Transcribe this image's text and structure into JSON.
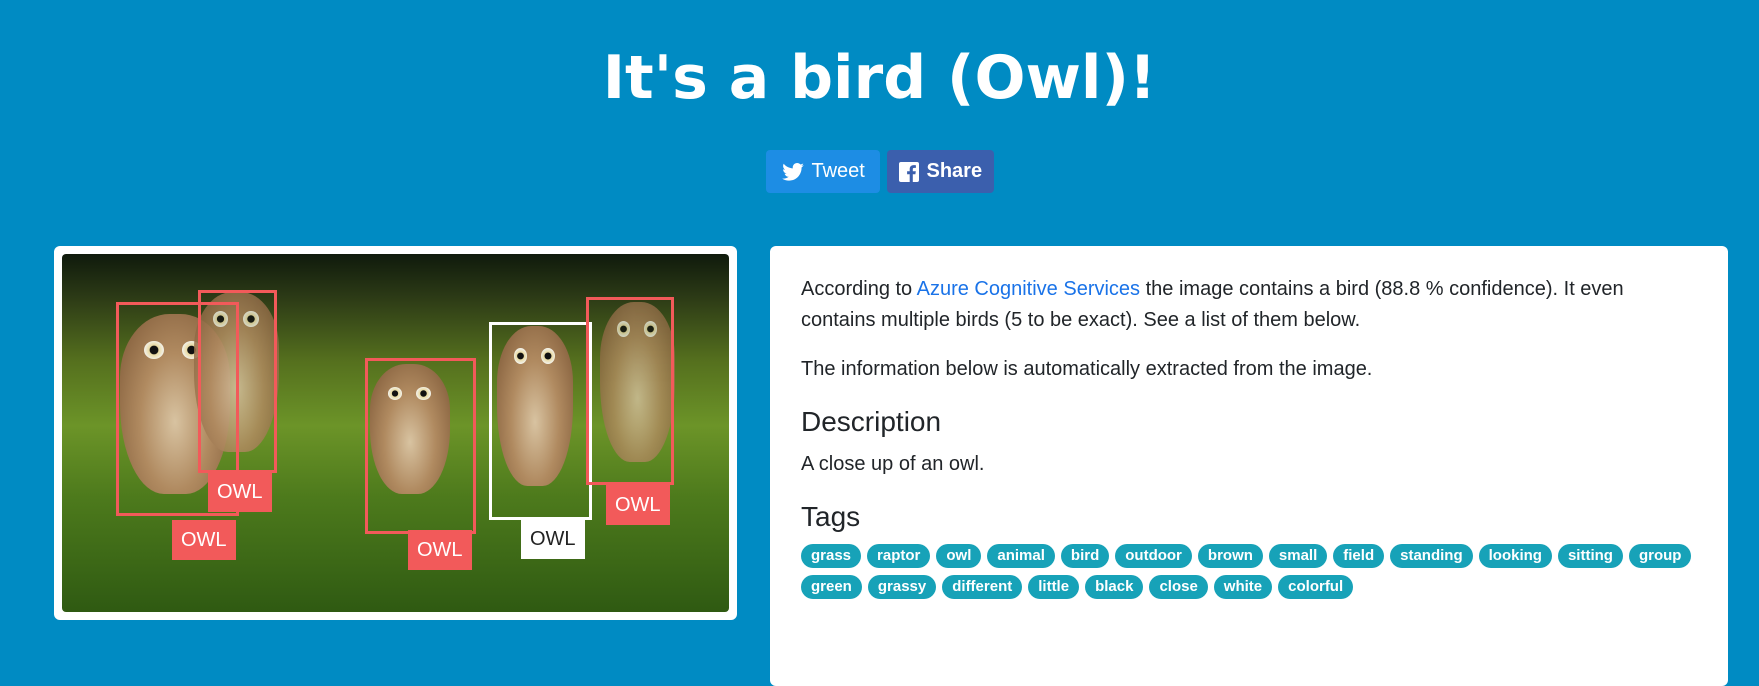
{
  "header": {
    "title": "It's a bird (Owl)!",
    "tweet_label": "Tweet",
    "share_label": "Share"
  },
  "image": {
    "detections": [
      {
        "label": "OWL"
      },
      {
        "label": "OWL"
      },
      {
        "label": "OWL"
      },
      {
        "label": "OWL"
      },
      {
        "label": "OWL"
      }
    ]
  },
  "info": {
    "intro_prefix": "According to ",
    "intro_link": "Azure Cognitive Services",
    "intro_suffix": " the image contains a bird (88.8 % confidence). It even contains multiple birds (5 to be exact). See a list of them below.",
    "auto_note": "The information below is automatically extracted from the image.",
    "description_heading": "Description",
    "description_text": "A close up of an owl.",
    "tags_heading": "Tags",
    "tags": [
      "grass",
      "raptor",
      "owl",
      "animal",
      "bird",
      "outdoor",
      "brown",
      "small",
      "field",
      "standing",
      "looking",
      "sitting",
      "group",
      "green",
      "grassy",
      "different",
      "little",
      "black",
      "close",
      "white",
      "colorful"
    ]
  },
  "colors": {
    "background": "#008bc3",
    "box": "#f25a5a",
    "box_selected": "#ffffff",
    "tag": "#17a2b8",
    "tweet": "#1d8de4",
    "share": "#3b5fad",
    "link": "#1a73e8"
  },
  "icons": {
    "tweet": "twitter-bird-icon",
    "share": "facebook-icon"
  }
}
